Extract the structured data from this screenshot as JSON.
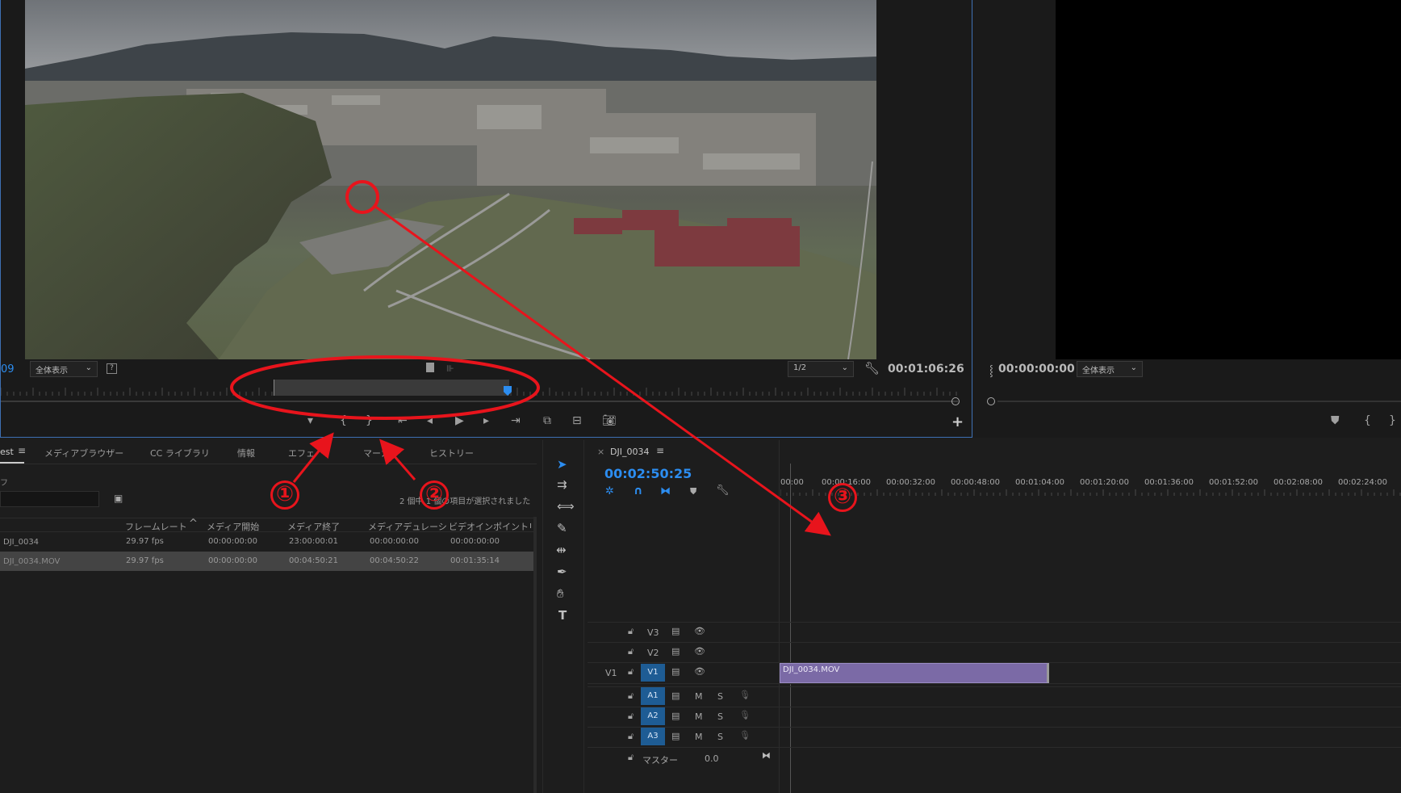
{
  "source_monitor": {
    "timecode_left": "09",
    "zoom_select": "全体表示",
    "resolution_select": "1/2",
    "duration": "00:01:06:26"
  },
  "program_monitor": {
    "timecode": "00:00:00:00",
    "zoom_select": "全体表示"
  },
  "project_panel": {
    "tabs": [
      "est",
      "メディアブラウザー",
      "CC ライブラリ",
      "情報",
      "エフェ",
      "マーカ",
      "ヒストリー"
    ],
    "truncated_label": "フ",
    "status": "2 個中 1 個の項目が選択されました",
    "columns": [
      "フレームレート",
      "メディア開始",
      "メディア終了",
      "メディアデュレーシ",
      "ビデオインポイント",
      "ı"
    ],
    "rows": [
      {
        "name": "DJI_0034",
        "fps": "29.97 fps",
        "start": "00:00:00:00",
        "end": "23:00:00:01",
        "duration": "00:00:00:00",
        "in": "00:00:00:00"
      },
      {
        "name": "DJI_0034.MOV",
        "fps": "29.97 fps",
        "start": "00:00:00:00",
        "end": "00:04:50:21",
        "duration": "00:04:50:22",
        "in": "00:01:35:14"
      }
    ]
  },
  "timeline": {
    "sequence_name": "DJI_0034",
    "timecode": "00:02:50:25",
    "ruler": [
      "00:00",
      "00:00:16:00",
      "00:00:32:00",
      "00:00:48:00",
      "00:01:04:00",
      "00:01:20:00",
      "00:01:36:00",
      "00:01:52:00",
      "00:02:08:00",
      "00:02:24:00"
    ],
    "tracks_video": [
      "V3",
      "V2",
      "V1"
    ],
    "tracks_audio": [
      "A1",
      "A2",
      "A3"
    ],
    "source_patch": "V1",
    "clip_name": "DJI_0034.MOV",
    "master_label": "マスター",
    "master_value": "0.0",
    "mute": "M",
    "solo": "S"
  },
  "annotations": {
    "marker_1": "①",
    "marker_2": "②",
    "marker_3": "③",
    "color": "#e8141c"
  }
}
